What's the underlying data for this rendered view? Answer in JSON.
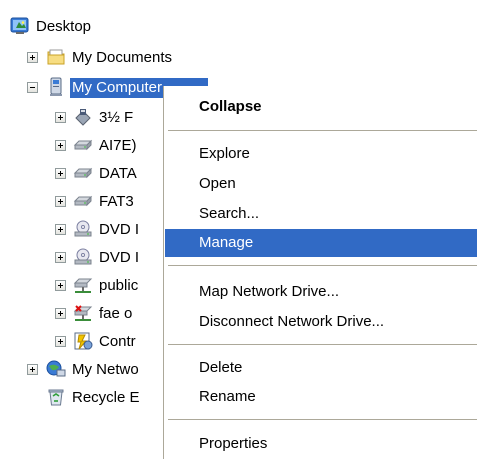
{
  "tree": {
    "desktop": "Desktop",
    "my_documents": "My Documents",
    "my_computer": "My Computer",
    "floppy": "3½ F",
    "drive_ai7": "AI7E)",
    "drive_data": "DATA",
    "drive_fat": "FAT3",
    "dvd1": "DVD I",
    "dvd2": "DVD I",
    "public": "public",
    "fae": "fae o",
    "control": "Contr",
    "network": "My Netwo",
    "recycle": "Recycle E"
  },
  "menu": {
    "collapse": "Collapse",
    "explore": "Explore",
    "open": "Open",
    "search": "Search...",
    "manage": "Manage",
    "map_drive": "Map Network Drive...",
    "disconnect_drive": "Disconnect Network Drive...",
    "delete": "Delete",
    "rename": "Rename",
    "properties": "Properties"
  },
  "colors": {
    "selection": "#316ac5",
    "separator": "#aca899"
  }
}
